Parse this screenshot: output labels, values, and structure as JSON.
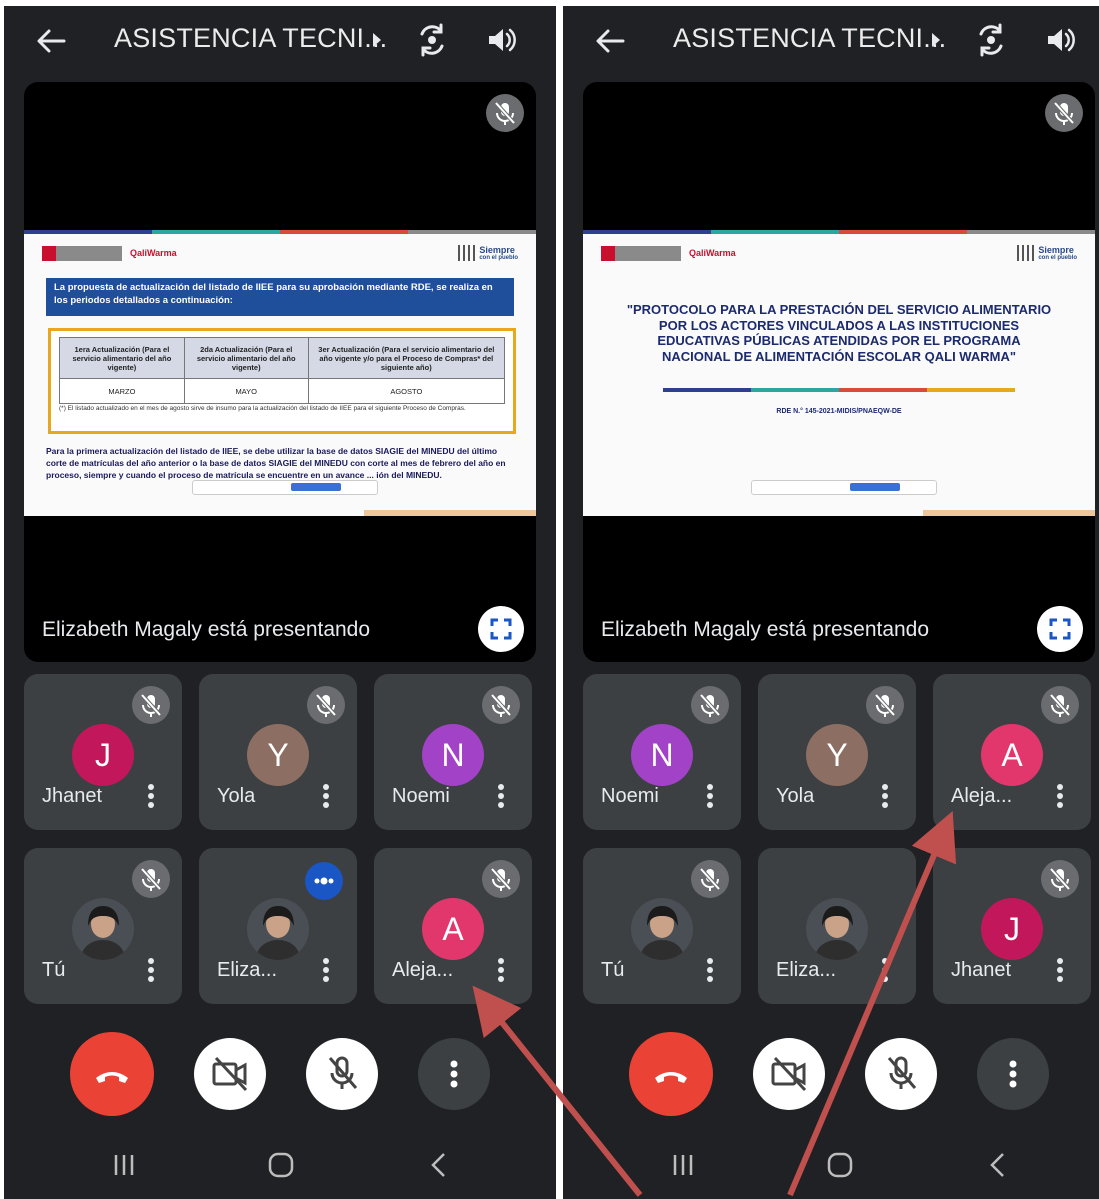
{
  "meeting_title": "ASISTENCIA TECNI...",
  "presenting_text": "Elizabeth Magaly está presentando",
  "colors": {
    "end_call": "#ea4335",
    "tile_bg": "#3c4043",
    "app_bg": "#202124",
    "annotation_arrow": "#c0504d"
  },
  "left_screen": {
    "slide": {
      "intro": "La propuesta de actualización del listado de IIEE para su aprobación mediante RDE, se realiza en los periodos detallados a continuación:",
      "table_headers": [
        "1era Actualización (Para el servicio alimentario del año vigente)",
        "2da Actualización (Para el servicio alimentario del año vigente)",
        "3er Actualización (Para el servicio alimentario del año vigente y/o para el Proceso de Compras* del siguiente año)"
      ],
      "table_values": [
        "MARZO",
        "MAYO",
        "AGOSTO"
      ],
      "note": "(*) El listado actualizado en el mes de agosto sirve de insumo para la actualización del listado de IIEE para el siguiente Proceso de Compras.",
      "paragraph": "Para la primera actualización del listado de IIEE, se debe utilizar la base de datos SIAGIE del MINEDU del último corte de matrículas del año anterior o la base de datos SIAGIE del MINEDU con corte al mes de febrero del año en proceso, siempre y cuando el proceso de matrícula se encuentre en un avance ... ión del MINEDU."
    },
    "tiles": [
      {
        "name": "Jhanet",
        "initial": "J",
        "color": "#c2185b",
        "type": "initial",
        "status": "muted"
      },
      {
        "name": "Yola",
        "initial": "Y",
        "color": "#8d6e63",
        "type": "initial",
        "status": "muted"
      },
      {
        "name": "Noemi",
        "initial": "N",
        "color": "#a142c7",
        "type": "initial",
        "status": "muted"
      },
      {
        "name": "Tú",
        "type": "photo",
        "status": "muted"
      },
      {
        "name": "Eliza...",
        "type": "photo",
        "status": "speaking"
      },
      {
        "name": "Aleja...",
        "initial": "A",
        "color": "#e2376d",
        "type": "initial",
        "status": "muted"
      }
    ]
  },
  "right_screen": {
    "slide": {
      "title": "\"PROTOCOLO PARA LA PRESTACIÓN DEL SERVICIO ALIMENTARIO POR LOS ACTORES VINCULADOS A LAS INSTITUCIONES EDUCATIVAS PÚBLICAS ATENDIDAS POR EL PROGRAMA NACIONAL DE ALIMENTACIÓN ESCOLAR QALI WARMA\"",
      "rde": "RDE N.° 145-2021-MIDIS/PNAEQW-DE"
    },
    "tiles": [
      {
        "name": "Noemi",
        "initial": "N",
        "color": "#a142c7",
        "type": "initial",
        "status": "muted"
      },
      {
        "name": "Yola",
        "initial": "Y",
        "color": "#8d6e63",
        "type": "initial",
        "status": "muted"
      },
      {
        "name": "Aleja...",
        "initial": "A",
        "color": "#e2376d",
        "type": "initial",
        "status": "muted"
      },
      {
        "name": "Tú",
        "type": "photo",
        "status": "muted"
      },
      {
        "name": "Eliza...",
        "type": "photo",
        "status": "none"
      },
      {
        "name": "Jhanet",
        "initial": "J",
        "color": "#c2185b",
        "type": "initial",
        "status": "muted"
      }
    ]
  },
  "slide_brand": {
    "program": "QaliWarma",
    "slogan_line1": "Siempre",
    "slogan_line2": "con el pueblo"
  }
}
